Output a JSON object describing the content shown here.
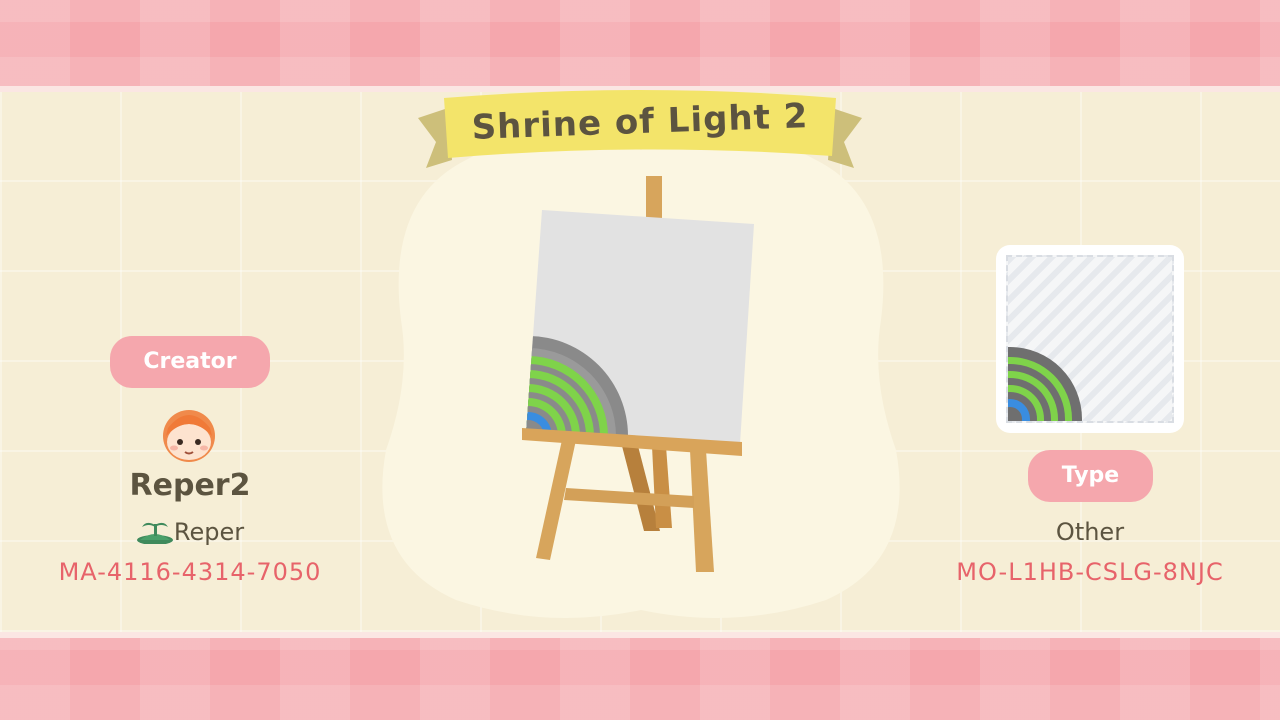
{
  "title": "Shrine of Light 2",
  "creator": {
    "label": "Creator",
    "name": "Reper2",
    "island": "Reper",
    "code": "MA-4116-4314-7050"
  },
  "design": {
    "type_label": "Type",
    "type_value": "Other",
    "code": "MO-L1HB-CSLG-8NJC"
  },
  "colors": {
    "pink": "#f5a7ad",
    "cream": "#f6eed6",
    "code_text": "#e7636a",
    "body_text": "#5c5440",
    "banner": "#f3e46a"
  },
  "icons": {
    "avatar": "villager-avatar-icon",
    "island": "island-palm-icon"
  }
}
